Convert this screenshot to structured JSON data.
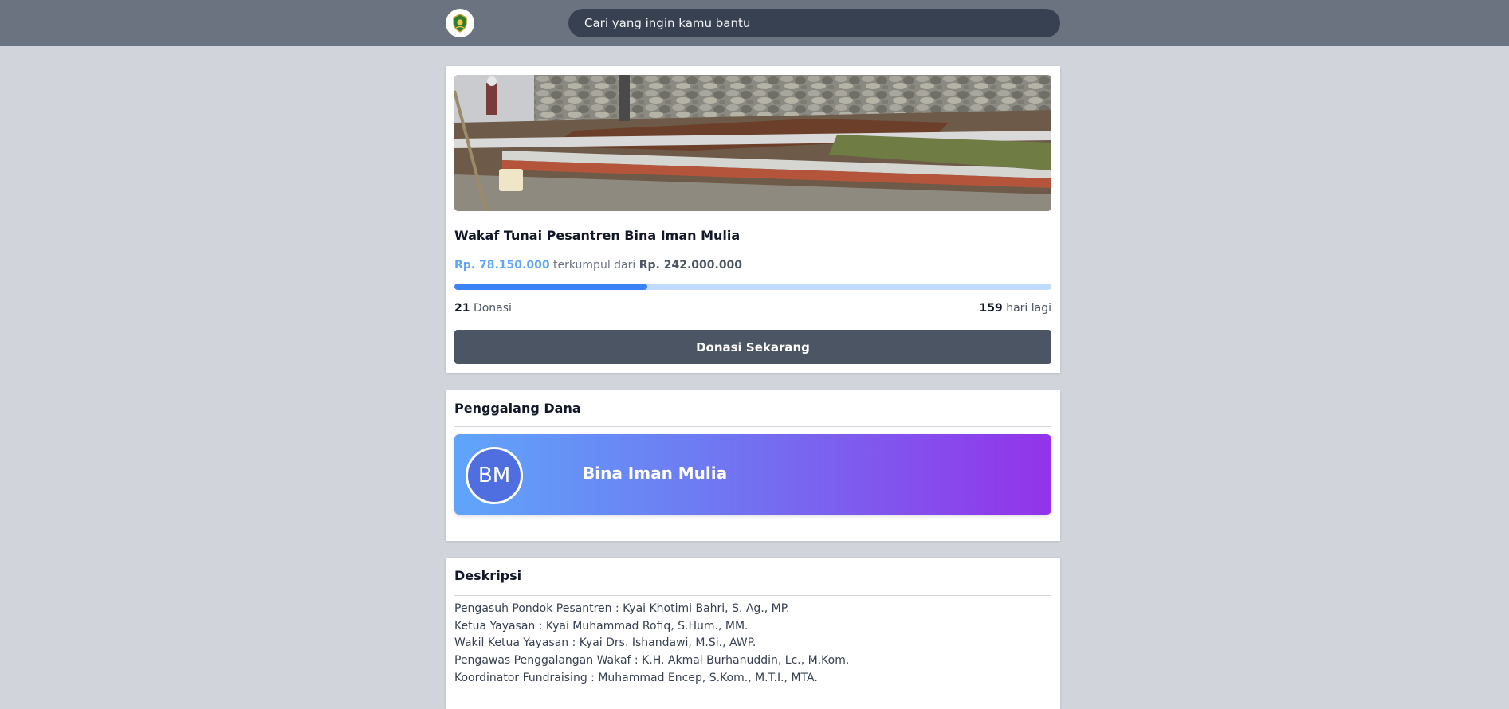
{
  "header": {
    "search_placeholder": "Cari yang ingin kamu bantu"
  },
  "campaign": {
    "title": "Wakaf Tunai Pesantren Bina Iman Mulia",
    "collected": "Rp. 78.150.000",
    "collected_suffix": "terkumpul dari",
    "target": "Rp. 242.000.000",
    "progress_fraction": 0.323,
    "donation_count": "21",
    "donation_label": "Donasi",
    "days_left": "159",
    "days_left_label": "hari lagi",
    "donate_button": "Donasi Sekarang"
  },
  "fundraiser": {
    "section_title": "Penggalang Dana",
    "initials": "BM",
    "name": "Bina Iman Mulia"
  },
  "description": {
    "section_title": "Deskripsi",
    "lines": [
      "Pengasuh Pondok Pesantren : Kyai Khotimi Bahri, S. Ag., MP.",
      "Ketua Yayasan : Kyai Muhammad Rofiq, S.Hum., MM.",
      "Wakil Ketua Yayasan : Kyai Drs. Ishandawi, M.Si., AWP.",
      "Pengawas Penggalangan Wakaf : K.H. Akmal Burhanuddin, Lc., M.Kom.",
      "Koordinator Fundraising : Muhammad Encep, S.Kom., M.T.I., MTA."
    ]
  },
  "colors": {
    "topbar": "#6b7280",
    "search_bg": "#374151",
    "accent": "#3b82f6",
    "button": "#4b5563"
  }
}
